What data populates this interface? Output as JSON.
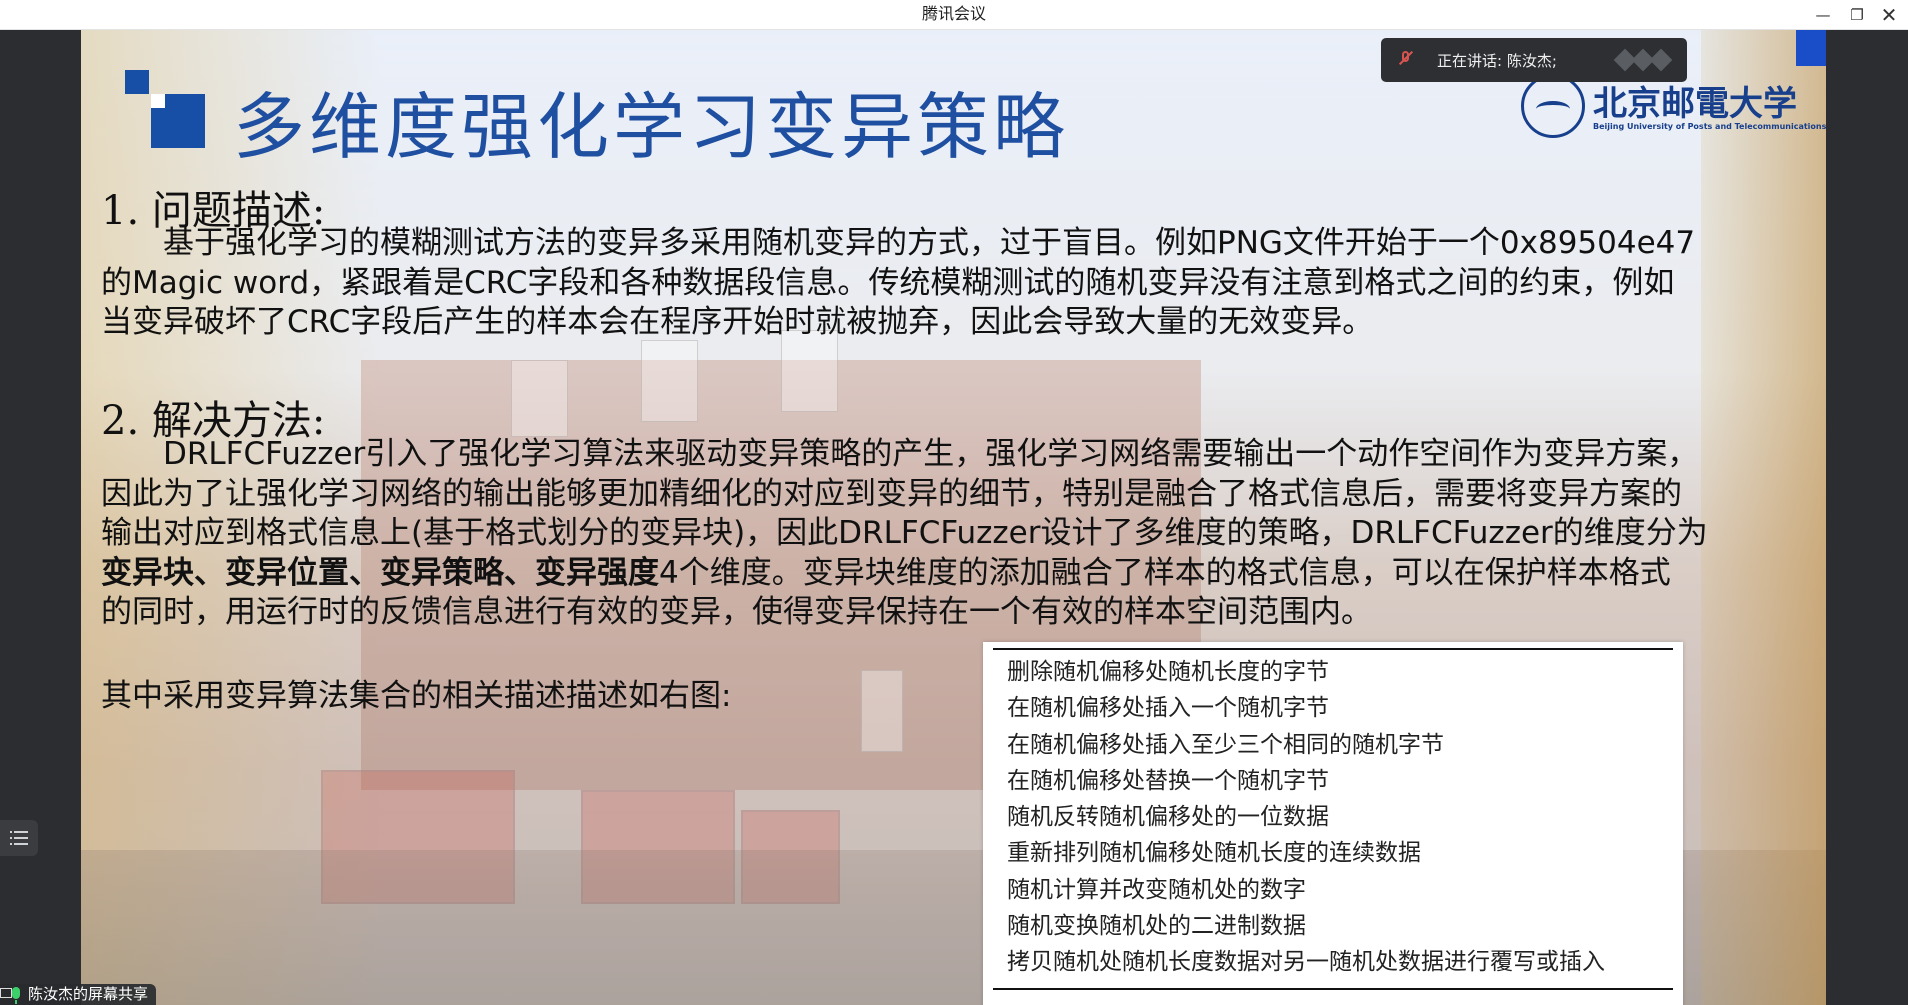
{
  "window": {
    "title": "腾讯会议",
    "controls": {
      "minimize": "—",
      "maximize": "❐",
      "close": "✕"
    }
  },
  "speaking": {
    "text": "正在讲话: 陈汝杰;"
  },
  "share": {
    "label": "陈汝杰的屏幕共享"
  },
  "slide": {
    "title": "多维度强化学习变异策略",
    "logo": {
      "name": "北京邮電大学",
      "subtitle": "Beijing University of Posts and Telecommunications"
    },
    "section1": {
      "heading": "1. 问题描述:",
      "lines": [
        "基于强化学习的模糊测试方法的变异多采用随机变异的方式，过于盲目。例如PNG文件开始于一个0x89504e47",
        "的Magic word，紧跟着是CRC字段和各种数据段信息。传统模糊测试的随机变异没有注意到格式之间的约束，例如",
        "当变异破坏了CRC字段后产生的样本会在程序开始时就被抛弃，因此会导致大量的无效变异。"
      ]
    },
    "section2": {
      "heading": "2. 解决方法:",
      "lines": [
        "DRLFCFuzzer引入了强化学习算法来驱动变异策略的产生，强化学习网络需要输出一个动作空间作为变异方案，",
        "因此为了让强化学习网络的输出能够更加精细化的对应到变异的细节，特别是融合了格式信息后，需要将变异方案的",
        "输出对应到格式信息上(基于格式划分的变异块)，因此DRLFCFuzzer设计了多维度的策略，DRLFCFuzzer的维度分为"
      ],
      "bold_text": "变异块、变异位置、变异策略、变异强度",
      "after_bold": "4个维度。变异块维度的添加融合了样本的格式信息，可以在保护样本格式",
      "last_line": "的同时，用运行时的反馈信息进行有效的变异，使得变异保持在一个有效的样本空间范围内。"
    },
    "note": "其中采用变异算法集合的相关描述描述如右图:",
    "algorithms": [
      "删除随机偏移处随机长度的字节",
      "在随机偏移处插入一个随机字节",
      "在随机偏移处插入至少三个相同的随机字节",
      "在随机偏移处替换一个随机字节",
      "随机反转随机偏移处的一位数据",
      "重新排列随机偏移处随机长度的连续数据",
      "随机计算并改变随机处的数字",
      "随机变换随机处的二进制数据",
      "拷贝随机处随机长度数据对另一随机处数据进行覆写或插入"
    ]
  },
  "colors": {
    "title_blue": "#1f4fa0",
    "logo_blue": "#173f8c",
    "dark_bg": "#2b2d30"
  }
}
